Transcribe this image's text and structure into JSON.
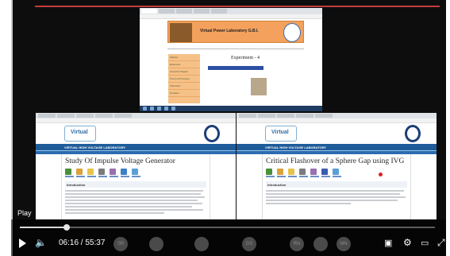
{
  "player": {
    "play_label": "Play",
    "current_time": "06:16",
    "duration": "55:37",
    "time_separator": " / ",
    "progress_fraction": 0.113,
    "colors": {
      "track": "#888888",
      "accent": "#dddddd",
      "background": "#0d0d0d"
    }
  },
  "top_screen": {
    "site_title": "Virtual Power Laboratory G.B.I.",
    "experiment_heading": "Experiment - 4",
    "side_menu": [
      "Objective",
      "Equipments",
      "Connection Diagram",
      "Theory and Procedure",
      "Observation",
      "Simulation"
    ]
  },
  "left_pane": {
    "banner": "VIRTUAL HIGH VOLTAGE LABORATORY",
    "page_title": "Study Of Impulse Voltage Generator",
    "section": "Introduction"
  },
  "right_pane": {
    "banner": "VIRTUAL HIGH VOLTAGE LABORATORY",
    "page_title": "Critical Flashover of a Sphere Gap using IVG",
    "section": "Introduction"
  },
  "logo_text": "Virtual",
  "participants": [
    "SR",
    "",
    "",
    "GS",
    "RN",
    "",
    "MN"
  ],
  "icons": [
    "play-icon",
    "volume-icon",
    "captions-icon",
    "gear-icon",
    "theater-icon",
    "fullscreen-icon"
  ]
}
